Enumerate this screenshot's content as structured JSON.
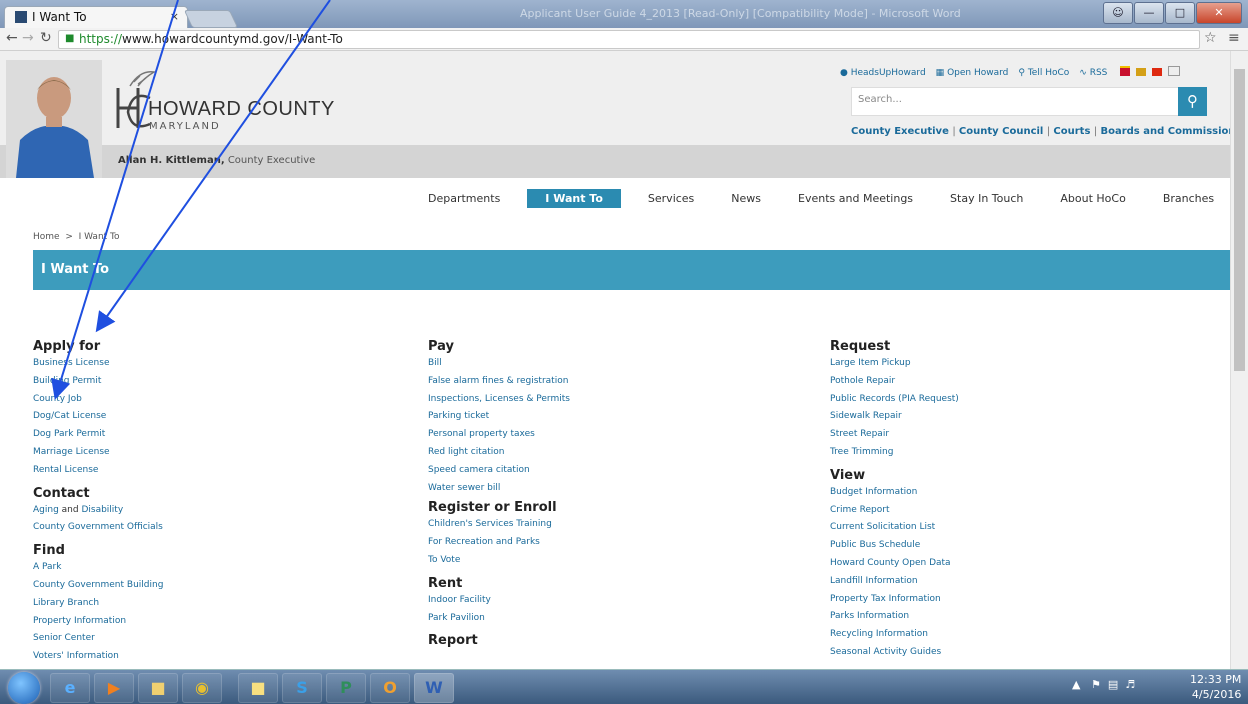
{
  "browser": {
    "tab_title": "I Want To",
    "tab_close": "×",
    "window_title": "Applicant User Guide 4_2013 [Read-Only] [Compatibility Mode] - Microsoft Word",
    "url_https": "https://",
    "url_rest": "www.howardcountymd.gov/I-Want-To"
  },
  "header": {
    "logo_title": "HOWARD COUNTY",
    "logo_subtitle": "MARYLAND",
    "exec_name": "Allan H. Kittleman,",
    "exec_role": " County Executive",
    "util_links": [
      "HeadsUpHoward",
      "Open Howard",
      "Tell HoCo",
      "RSS"
    ],
    "search_placeholder": "Search...",
    "top_links": [
      "County Executive",
      "County Council",
      "Courts",
      "Boards and Commissions"
    ]
  },
  "nav": {
    "items": [
      "Departments",
      "I Want To",
      "Services",
      "News",
      "Events and Meetings",
      "Stay In Touch",
      "About HoCo",
      "Branches"
    ]
  },
  "breadcrumb": {
    "home": "Home",
    "sep": ">",
    "current": "I Want To"
  },
  "banner": {
    "title": "I Want To"
  },
  "columns": {
    "apply": {
      "heading": "Apply for",
      "links": [
        "Business License",
        "Building Permit",
        "County Job",
        "Dog/Cat License",
        "Dog Park Permit",
        "Marriage License",
        "Rental License"
      ]
    },
    "contact": {
      "heading": "Contact",
      "aging": "Aging",
      "and": " and ",
      "disability": "Disability",
      "officials": "County Government Officials"
    },
    "find": {
      "heading": "Find",
      "links": [
        "A Park",
        "County Government Building",
        "Library Branch",
        "Property Information",
        "Senior Center",
        "Voters' Information"
      ]
    },
    "pay": {
      "heading": "Pay",
      "links": [
        "Bill",
        "False alarm fines & registration",
        "Inspections, Licenses & Permits",
        "Parking ticket",
        "Personal property taxes",
        "Red light citation",
        "Speed camera citation",
        "Water sewer bill"
      ]
    },
    "register": {
      "heading": "Register or Enroll",
      "links": [
        "Children's Services Training",
        "For Recreation and Parks",
        "To Vote"
      ]
    },
    "rent": {
      "heading": "Rent",
      "links": [
        "Indoor Facility",
        "Park Pavilion"
      ]
    },
    "report": {
      "heading": "Report"
    },
    "request": {
      "heading": "Request",
      "links": [
        "Large Item Pickup",
        "Pothole Repair",
        "Public Records (PIA Request)",
        "Sidewalk Repair",
        "Street Repair",
        "Tree Trimming"
      ]
    },
    "view": {
      "heading": "View",
      "links": [
        "Budget Information",
        "Crime Report",
        "Current Solicitation List",
        "Public Bus Schedule",
        "Howard County Open Data",
        "Landfill Information",
        "Property Tax Information",
        "Parks Information",
        "Recycling Information",
        "Seasonal Activity Guides"
      ]
    }
  },
  "taskbar": {
    "time": "12:33 PM",
    "date": "4/5/2016"
  },
  "colors": {
    "accent": "#2b8bb1",
    "banner": "#3d9cbd",
    "link": "#1a6a9a",
    "arrow": "#1f4fe0"
  }
}
